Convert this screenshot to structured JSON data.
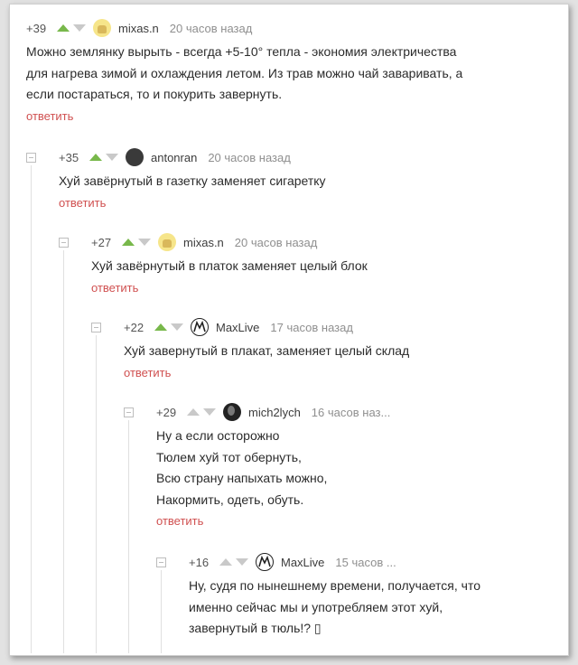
{
  "reply_label": "ответить",
  "comments": [
    {
      "rating": "+39",
      "author": "mixas.n",
      "time": "20 часов назад",
      "lines": [
        "Можно землянку вырыть - всегда +5-10° тепла - экономия электричества",
        "для нагрева зимой и охлаждения летом. Из трав можно чай заваривать, а",
        "если постараться, то и покурить завернуть."
      ]
    },
    {
      "rating": "+35",
      "author": "antonran",
      "time": "20 часов назад",
      "lines": [
        "Хуй завёрнутый в газетку заменяет сигаретку"
      ]
    },
    {
      "rating": "+27",
      "author": "mixas.n",
      "time": "20 часов назад",
      "lines": [
        "Хуй завёрнутый в платок заменяет целый блок"
      ]
    },
    {
      "rating": "+22",
      "author": "MaxLive",
      "time": "17 часов назад",
      "lines": [
        "Хуй завернутый в плакат, заменяет целый склад"
      ]
    },
    {
      "rating": "+29",
      "author": "mich2lych",
      "time": "16 часов наз...",
      "lines": [
        "Ну а если осторожно",
        "Тюлем хуй тот обернуть,",
        "Всю страну напыхать можно,",
        "Накормить, одеть, обуть."
      ]
    },
    {
      "rating": "+16",
      "author": "MaxLive",
      "time": "15 часов ...",
      "lines": [
        "Ну, судя по нынешнему времени, получается, что",
        "именно сейчас мы и употребляем этот хуй,",
        "завернутый в тюль!? ▯"
      ]
    }
  ]
}
